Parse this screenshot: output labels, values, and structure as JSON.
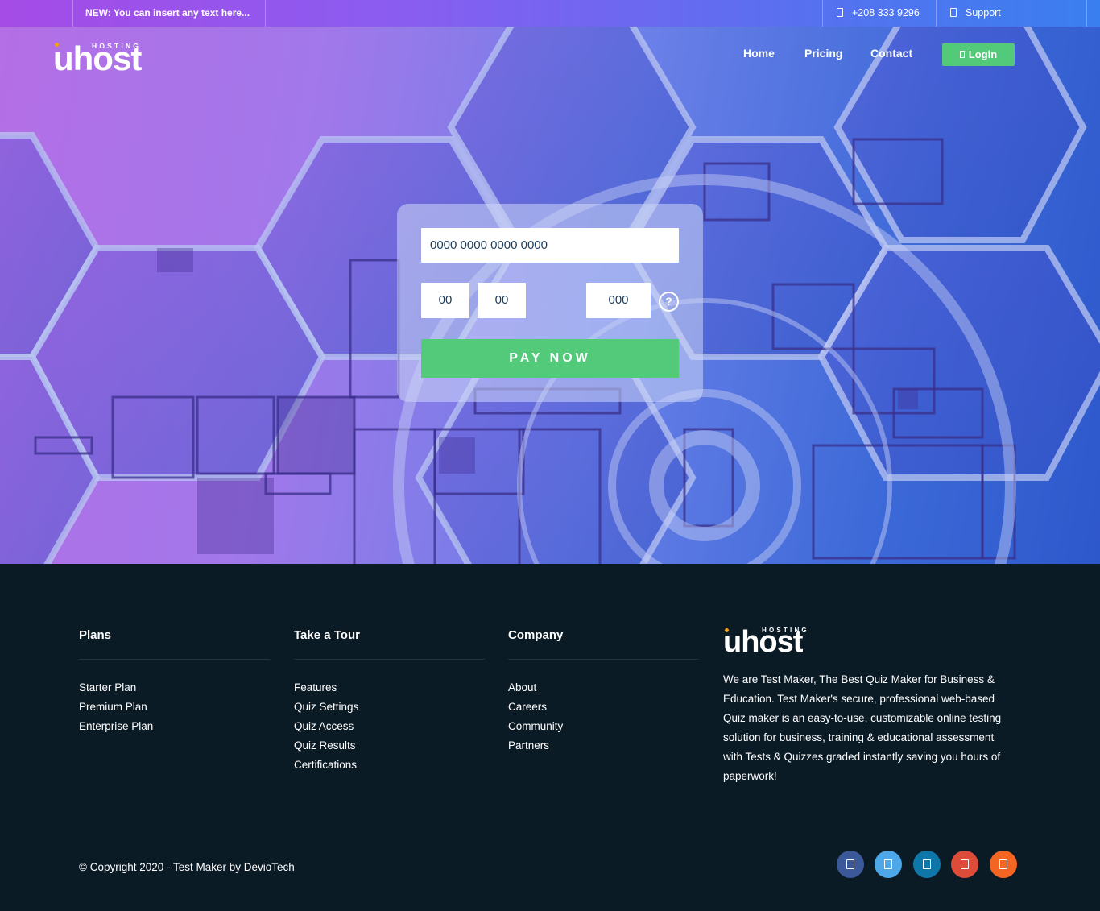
{
  "topbar": {
    "notice": "NEW: You can insert any text here...",
    "phone": "+208 333 9296",
    "support": "Support"
  },
  "brand": {
    "hosting": "HOSTING",
    "name": "uhost"
  },
  "nav": {
    "home": "Home",
    "pricing": "Pricing",
    "contact": "Contact",
    "login": "Login"
  },
  "payment": {
    "card_number_placeholder": "0000 0000 0000 0000",
    "month_placeholder": "00",
    "year_placeholder": "00",
    "cvv_placeholder": "000",
    "help": "?",
    "button": "PAY NOW"
  },
  "footer": {
    "plans": {
      "title": "Plans",
      "items": [
        "Starter Plan",
        "Premium Plan",
        "Enterprise Plan"
      ]
    },
    "tour": {
      "title": "Take a Tour",
      "items": [
        "Features",
        "Quiz Settings",
        "Quiz Access",
        "Quiz Results",
        "Certifications"
      ]
    },
    "company": {
      "title": "Company",
      "items": [
        "About",
        "Careers",
        "Community",
        "Partners"
      ]
    },
    "about": "We are Test Maker, The Best Quiz Maker for Business & Education. Test Maker's secure, professional web-based Quiz maker is an easy-to-use, customizable online testing solution for business, training & educational assessment with Tests & Quizzes graded instantly saving you hours of paperwork!",
    "copyright": "© Copyright 2020 - Test Maker by DevioTech",
    "social": [
      {
        "icon": "facebook-icon",
        "color": "#3b5998"
      },
      {
        "icon": "twitter-icon",
        "color": "#4da7e8"
      },
      {
        "icon": "linkedin-icon",
        "color": "#0e76a8"
      },
      {
        "icon": "google-plus-icon",
        "color": "#dd4b39"
      },
      {
        "icon": "rss-icon",
        "color": "#f26522"
      }
    ]
  },
  "colors": {
    "accent_green": "#53c97a",
    "footer_bg": "#0b1b26",
    "logo_dot": "#f3a21d"
  }
}
